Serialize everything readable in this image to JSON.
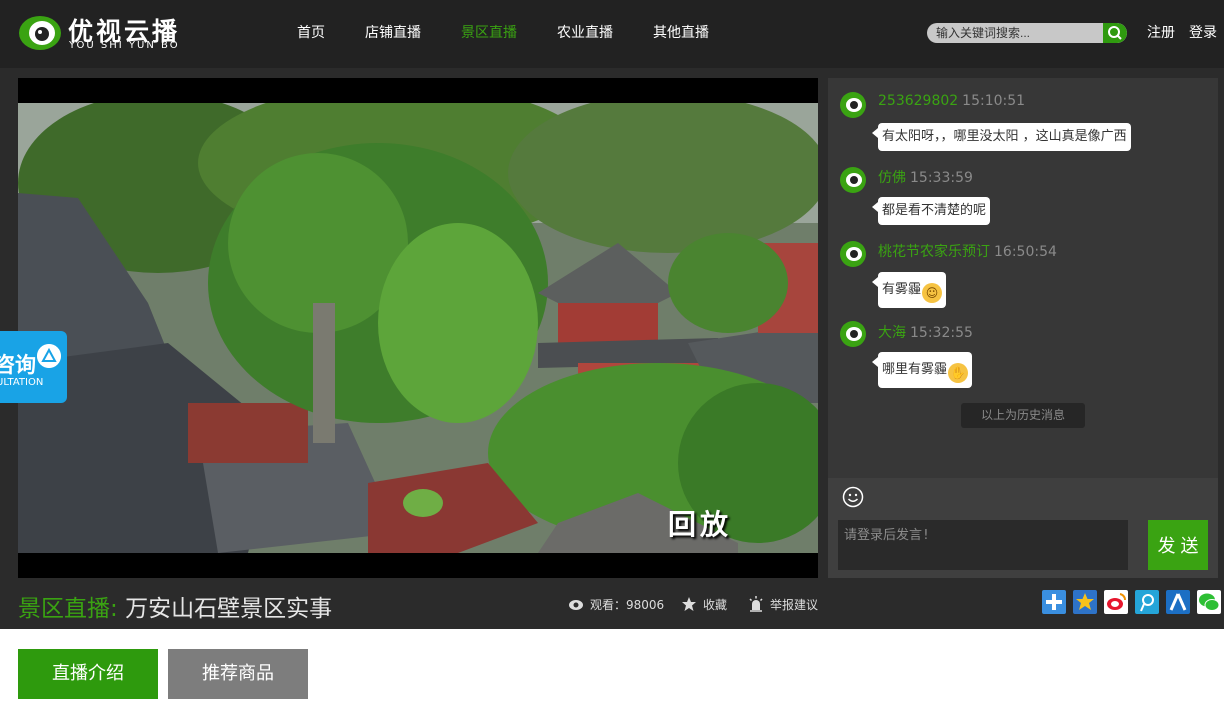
{
  "header": {
    "logo_text": "优视云播",
    "logo_sub": "YOU SHI YUN BO",
    "nav": [
      {
        "label": "首页"
      },
      {
        "label": "店铺直播"
      },
      {
        "label": "景区直播"
      },
      {
        "label": "农业直播"
      },
      {
        "label": "其他直播"
      }
    ],
    "active_nav": "景区直播",
    "search_placeholder": "输入关键词搜索...",
    "register_label": "注册",
    "login_label": "登录",
    "accent_color": "#3aa312"
  },
  "video": {
    "overlay_text": "回放",
    "consult_label": "咨询",
    "consult_sub": "ULTATION"
  },
  "stream": {
    "title_prefix": "景区直播:",
    "title": "万安山石壁景区实事",
    "views": "观看：98006",
    "favorite_label": "收藏",
    "report_label": "举报建议",
    "share_icons": [
      "qq-space-icon",
      "star-icon",
      "weibo-icon",
      "tencent-weibo-icon",
      "renren-icon",
      "wechat-icon"
    ]
  },
  "chat": {
    "messages": [
      {
        "user": "253629802",
        "time": "15:10:51",
        "text": "有太阳呀，，哪里没太阳 ，这山真是像广西",
        "emoji": ""
      },
      {
        "user": "仿佛",
        "time": "15:33:59",
        "text": "都是看不清楚的呢",
        "emoji": ""
      },
      {
        "user": "桃花节农家乐预订",
        "time": "16:50:54",
        "text": "有雾霾",
        "emoji": "grin-emoji"
      },
      {
        "user": "大海",
        "time": "15:32:55",
        "text": "哪里有雾霾",
        "emoji": "pray-emoji"
      }
    ],
    "history_label": "以上为历史消息",
    "input_placeholder": "请登录后发言!",
    "send_label": "发 送"
  },
  "tabs": {
    "intro_label": "直播介绍",
    "products_label": "推荐商品"
  }
}
